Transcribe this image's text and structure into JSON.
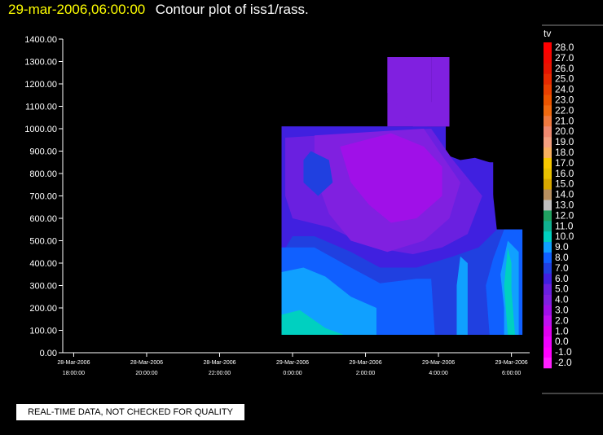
{
  "header": {
    "date": "29-mar-2006,06:00:00",
    "title": "Contour plot of iss1/rass."
  },
  "notice": "REAL-TIME DATA, NOT CHECKED FOR QUALITY",
  "colors": {
    "background": "#000000",
    "axis": "#ffffff",
    "date_text": "#ffff00"
  },
  "chart_data": {
    "type": "heatmap",
    "title": "Contour plot of iss1/rass.",
    "variable": "tv",
    "y_ticks": [
      "0.00",
      "100.00",
      "200.00",
      "300.00",
      "400.00",
      "500.00",
      "600.00",
      "700.00",
      "800.00",
      "900.00",
      "1000.00",
      "1100.00",
      "1200.00",
      "1300.00",
      "1400.00"
    ],
    "ylim": [
      0,
      1400
    ],
    "x_ticks": [
      {
        "date": "28-Mar-2006",
        "time": "18:00:00",
        "hours": 0
      },
      {
        "date": "28-Mar-2006",
        "time": "20:00:00",
        "hours": 2
      },
      {
        "date": "28-Mar-2006",
        "time": "22:00:00",
        "hours": 4
      },
      {
        "date": "29-Mar-2006",
        "time": "0:00:00",
        "hours": 6
      },
      {
        "date": "29-Mar-2006",
        "time": "2:00:00",
        "hours": 8
      },
      {
        "date": "29-Mar-2006",
        "time": "4:00:00",
        "hours": 10
      },
      {
        "date": "29-Mar-2006",
        "time": "6:00:00",
        "hours": 12
      }
    ],
    "xlim": [
      -0.3,
      12.5
    ],
    "colorbar": {
      "label": "tv",
      "levels": [
        "28.0",
        "27.0",
        "26.0",
        "25.0",
        "24.0",
        "23.0",
        "22.0",
        "21.0",
        "20.0",
        "19.0",
        "18.0",
        "17.0",
        "16.0",
        "15.0",
        "14.0",
        "13.0",
        "12.0",
        "11.0",
        "10.0",
        "9.0",
        "8.0",
        "7.0",
        "6.0",
        "5.0",
        "4.0",
        "3.0",
        "2.0",
        "1.0",
        "0.0",
        "-1.0",
        "-2.0"
      ],
      "colors": [
        "#ff0000",
        "#f20800",
        "#e61500",
        "#e82a00",
        "#ea4000",
        "#ec5500",
        "#f06a10",
        "#f07a40",
        "#f08a70",
        "#f4a080",
        "#f8b060",
        "#f8c800",
        "#e8c000",
        "#d8a800",
        "#b89060",
        "#c0c0c0",
        "#20a060",
        "#10b090",
        "#00d0c0",
        "#10a0ff",
        "#1060ff",
        "#2040e0",
        "#4020e0",
        "#6a20e0",
        "#8020e0",
        "#a010e8",
        "#c010f0",
        "#e000f0",
        "#f000ff",
        "#ff00ff",
        "#ff20ff"
      ]
    },
    "blocks": [
      {
        "x0": 5.7,
        "x1": 10.2,
        "y0": 80,
        "y1": 1010,
        "value": 6.0
      },
      {
        "x0": 8.6,
        "x1": 9.8,
        "y0": 1010,
        "y1": 1320,
        "value": 4.0
      },
      {
        "x0": 9.8,
        "x1": 10.3,
        "y0": 1010,
        "y1": 1320,
        "value": 4.0
      },
      {
        "x0": 10.2,
        "x1": 11.5,
        "y0": 80,
        "y1": 850,
        "value": 6.0
      },
      {
        "x0": 11.5,
        "x1": 12.3,
        "y0": 80,
        "y1": 550,
        "value": 8.0
      }
    ],
    "regions": [
      {
        "value": 6.0,
        "points": [
          [
            5.7,
            80
          ],
          [
            12.3,
            80
          ],
          [
            12.3,
            550
          ],
          [
            11.6,
            550
          ],
          [
            11.4,
            850
          ],
          [
            11.0,
            870
          ],
          [
            10.6,
            860
          ],
          [
            10.1,
            890
          ],
          [
            9.7,
            940
          ],
          [
            9.7,
            1010
          ],
          [
            5.7,
            1010
          ]
        ]
      },
      {
        "value": 7.0,
        "points": [
          [
            5.7,
            80
          ],
          [
            12.3,
            80
          ],
          [
            12.3,
            550
          ],
          [
            11.6,
            550
          ],
          [
            11.1,
            470
          ],
          [
            10.4,
            430
          ],
          [
            9.4,
            380
          ],
          [
            8.4,
            380
          ],
          [
            7.6,
            450
          ],
          [
            6.6,
            520
          ],
          [
            6.0,
            520
          ],
          [
            5.7,
            440
          ]
        ]
      },
      {
        "value": 8.0,
        "points": [
          [
            5.7,
            80
          ],
          [
            9.9,
            80
          ],
          [
            9.8,
            330
          ],
          [
            9.4,
            330
          ],
          [
            8.4,
            310
          ],
          [
            7.6,
            380
          ],
          [
            6.6,
            470
          ],
          [
            5.7,
            470
          ]
        ]
      },
      {
        "value": 8.0,
        "points": [
          [
            11.4,
            80
          ],
          [
            12.3,
            80
          ],
          [
            12.3,
            550
          ],
          [
            11.8,
            550
          ],
          [
            11.5,
            420
          ],
          [
            11.3,
            300
          ]
        ]
      },
      {
        "value": 9.0,
        "points": [
          [
            5.7,
            80
          ],
          [
            8.3,
            80
          ],
          [
            8.3,
            200
          ],
          [
            7.6,
            250
          ],
          [
            6.9,
            340
          ],
          [
            6.3,
            380
          ],
          [
            5.7,
            360
          ]
        ]
      },
      {
        "value": 9.0,
        "points": [
          [
            11.8,
            80
          ],
          [
            12.2,
            80
          ],
          [
            12.2,
            450
          ],
          [
            11.9,
            500
          ],
          [
            11.7,
            350
          ],
          [
            11.8,
            200
          ]
        ]
      },
      {
        "value": 9.0,
        "points": [
          [
            10.5,
            80
          ],
          [
            10.8,
            80
          ],
          [
            10.8,
            400
          ],
          [
            10.6,
            430
          ],
          [
            10.5,
            300
          ]
        ]
      },
      {
        "value": 10.0,
        "points": [
          [
            5.7,
            80
          ],
          [
            7.4,
            80
          ],
          [
            6.9,
            110
          ],
          [
            6.2,
            190
          ],
          [
            5.7,
            170
          ]
        ]
      },
      {
        "value": 10.0,
        "points": [
          [
            11.9,
            80
          ],
          [
            12.1,
            80
          ],
          [
            12.0,
            280
          ],
          [
            12.0,
            400
          ],
          [
            11.9,
            470
          ],
          [
            11.8,
            300
          ]
        ]
      },
      {
        "value": 5.0,
        "points": [
          [
            5.8,
            960
          ],
          [
            9.8,
            1000
          ],
          [
            10.4,
            860
          ],
          [
            11.2,
            700
          ],
          [
            10.8,
            530
          ],
          [
            10.1,
            470
          ],
          [
            9.3,
            440
          ],
          [
            8.2,
            470
          ],
          [
            7.0,
            560
          ],
          [
            6.0,
            600
          ],
          [
            5.8,
            700
          ]
        ]
      },
      {
        "value": 4.0,
        "points": [
          [
            6.6,
            970
          ],
          [
            9.6,
            1000
          ],
          [
            10.1,
            880
          ],
          [
            10.6,
            760
          ],
          [
            10.3,
            600
          ],
          [
            9.6,
            500
          ],
          [
            8.6,
            450
          ],
          [
            7.6,
            500
          ],
          [
            7.0,
            620
          ],
          [
            6.6,
            800
          ]
        ]
      },
      {
        "value": 4.0,
        "points": [
          [
            8.6,
            1320
          ],
          [
            9.8,
            1320
          ],
          [
            9.8,
            1120
          ],
          [
            10.3,
            1010
          ],
          [
            9.3,
            1010
          ],
          [
            8.6,
            1160
          ]
        ]
      },
      {
        "value": 3.0,
        "points": [
          [
            7.3,
            920
          ],
          [
            8.7,
            980
          ],
          [
            9.6,
            920
          ],
          [
            10.1,
            830
          ],
          [
            10.1,
            700
          ],
          [
            9.4,
            600
          ],
          [
            8.7,
            580
          ],
          [
            8.1,
            660
          ],
          [
            7.6,
            760
          ]
        ]
      },
      {
        "value": 7.0,
        "points": [
          [
            6.5,
            900
          ],
          [
            7.0,
            860
          ],
          [
            7.1,
            760
          ],
          [
            6.7,
            700
          ],
          [
            6.3,
            760
          ],
          [
            6.3,
            860
          ]
        ]
      }
    ]
  }
}
